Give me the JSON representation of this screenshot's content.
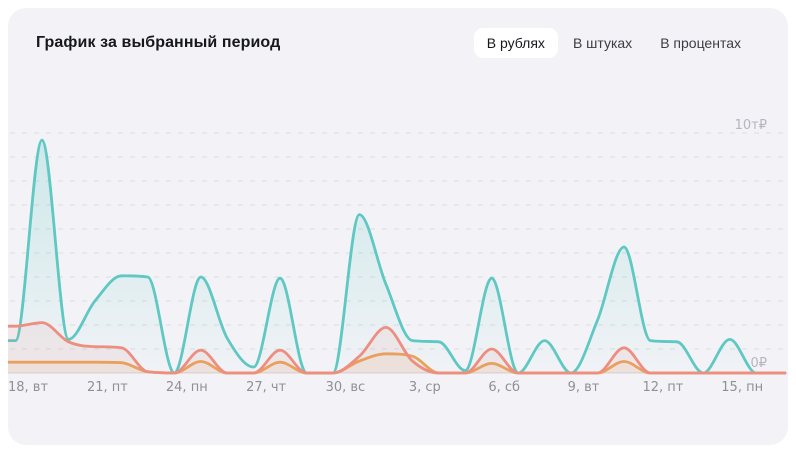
{
  "header": {
    "title": "График за выбранный период"
  },
  "tabs": [
    {
      "label": "В рублях",
      "active": true
    },
    {
      "label": "В штуках",
      "active": false
    },
    {
      "label": "В процентах",
      "active": false
    }
  ],
  "colors": {
    "card_bg": "#f3f3f7",
    "teal": "#5fc8c2",
    "salmon": "#ee8e81",
    "orange": "#e8a35b",
    "grid": "#dbdce2",
    "axis": "#d9dade",
    "x_label": "#8f9096",
    "y_label": "#b5b6bd",
    "title": "#17181c"
  },
  "chart_data": {
    "type": "area",
    "title": "График за выбранный период",
    "legend": "none",
    "grid": "dashed-horizontal",
    "n_points": 29,
    "tick_labels": [
      "18, вт",
      "21, пт",
      "24, пн",
      "27, чт",
      "30, вс",
      "3, ср",
      "6, сб",
      "9, вт",
      "12, пт",
      "15, пн"
    ],
    "tick_point_indices": [
      1,
      4,
      7,
      10,
      13,
      16,
      19,
      22,
      25,
      28
    ],
    "y_axis": {
      "ymin": 0,
      "ymax": 10000,
      "grid_step": 1000,
      "top_label": "10т₽",
      "bottom_label": "0₽"
    },
    "series": [
      {
        "name": "teal-series",
        "color": "#5fc8c2",
        "values": [
          1350,
          9700,
          1400,
          3000,
          4050,
          4000,
          0,
          4000,
          1450,
          250,
          3950,
          0,
          0,
          6600,
          3700,
          1350,
          1300,
          100,
          3950,
          0,
          1350,
          0,
          2200,
          5250,
          1350,
          1300,
          0,
          1400,
          0
        ]
      },
      {
        "name": "salmon-series",
        "color": "#ee8e81",
        "values": [
          1950,
          2100,
          1300,
          1100,
          1050,
          50,
          0,
          950,
          0,
          0,
          950,
          0,
          0,
          700,
          1900,
          500,
          0,
          0,
          1000,
          0,
          0,
          0,
          0,
          1050,
          0,
          0,
          0,
          0,
          0
        ]
      },
      {
        "name": "orange-series",
        "color": "#e8a35b",
        "values": [
          450,
          450,
          450,
          450,
          430,
          50,
          0,
          480,
          0,
          0,
          450,
          0,
          0,
          500,
          800,
          700,
          0,
          0,
          400,
          0,
          0,
          0,
          0,
          480,
          0,
          0,
          0,
          0,
          0
        ]
      }
    ]
  }
}
